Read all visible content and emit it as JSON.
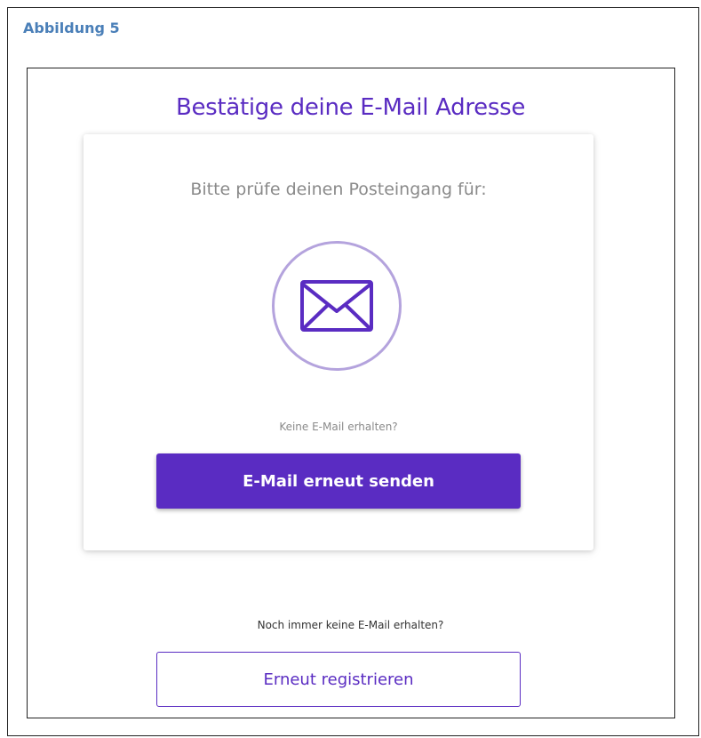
{
  "document": {
    "caption": "Abbildung 5"
  },
  "page": {
    "title": "Bestätige deine E-Mail Adresse"
  },
  "card": {
    "instruction": "Bitte prüfe deinen Posteingang für:",
    "icon": "envelope-icon",
    "no_mail_text": "Keine E-Mail erhalten?",
    "resend_label": "E-Mail erneut senden"
  },
  "footer": {
    "still_no_mail_text": "Noch immer keine E-Mail erhalten?",
    "register_label": "Erneut registrieren"
  },
  "colors": {
    "accent": "#5a2cc2",
    "circle": "#b4a3dd",
    "caption": "#4a7fb8",
    "muted_text": "#8a8a8a"
  }
}
